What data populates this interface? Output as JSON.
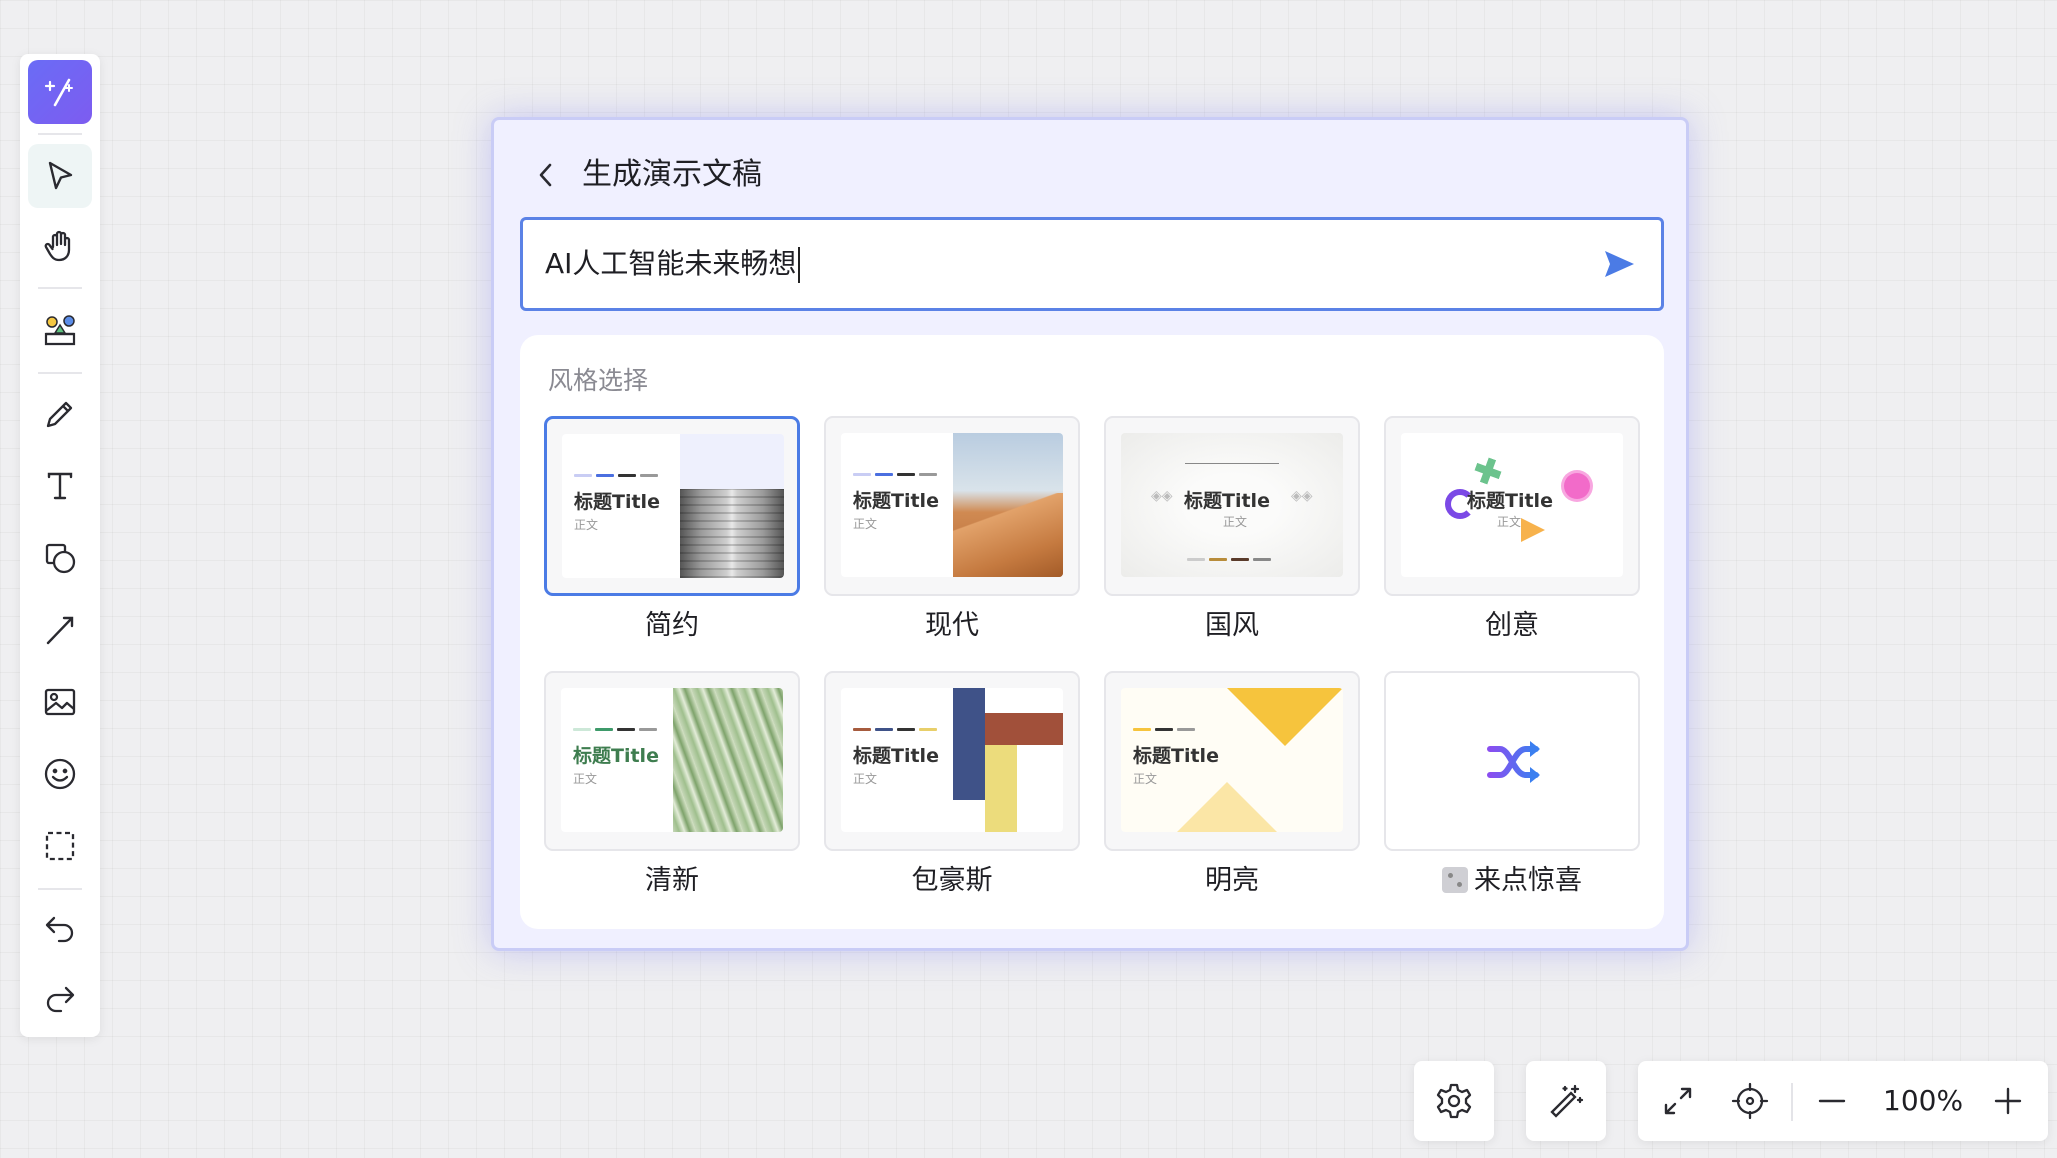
{
  "toolbar": {
    "items": [
      {
        "icon": "ai-magic-icon",
        "active": true
      },
      {
        "icon": "select-cursor-icon",
        "active": true
      },
      {
        "icon": "hand-pan-icon"
      },
      {
        "icon": "stickers-icon"
      },
      {
        "icon": "pencil-icon"
      },
      {
        "icon": "text-icon"
      },
      {
        "icon": "shapes-icon"
      },
      {
        "icon": "line-icon"
      },
      {
        "icon": "image-icon"
      },
      {
        "icon": "emoji-icon"
      },
      {
        "icon": "frame-select-icon"
      },
      {
        "icon": "undo-icon"
      },
      {
        "icon": "redo-icon"
      }
    ]
  },
  "dialog": {
    "title": "生成演示文稿",
    "prompt_value": "AI人工智能未来畅想",
    "style_section_label": "风格选择",
    "styles": [
      {
        "name": "简约",
        "selected": true,
        "slide_title": "标题Title",
        "slide_body": "正文"
      },
      {
        "name": "现代",
        "slide_title": "标题Title",
        "slide_body": "正文"
      },
      {
        "name": "国风",
        "slide_title": "标题Title",
        "slide_body": "正文"
      },
      {
        "name": "创意",
        "slide_title": "标题Title",
        "slide_body": "正文"
      },
      {
        "name": "清新",
        "slide_title": "标题Title",
        "slide_body": "正文"
      },
      {
        "name": "包豪斯",
        "slide_title": "标题Title",
        "slide_body": "正文"
      },
      {
        "name": "明亮",
        "slide_title": "标题Title",
        "slide_body": "正文"
      },
      {
        "name": "来点惊喜",
        "icon": "shuffle-icon"
      }
    ]
  },
  "bottom_controls": {
    "zoom_level": "100%"
  },
  "colors": {
    "accent": "#4b7be5",
    "ai_button": "#6a6cf6",
    "dialog_border": "#c9ccf6"
  }
}
